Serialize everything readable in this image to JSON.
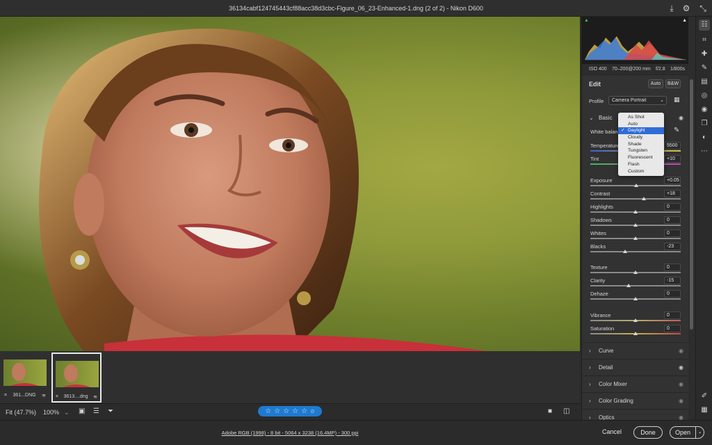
{
  "window": {
    "title": "36134cabf124745443cf88acc38d3cbc-Figure_06_23-Enhanced-1.dng (2 of 2)  -  Nikon D600"
  },
  "filmstrip": {
    "items": [
      {
        "label": "361...DNG"
      },
      {
        "label": "3613....dng"
      }
    ]
  },
  "viewbar": {
    "fit_label": "Fit (47.7%)",
    "zoom_label": "100%"
  },
  "rating": {
    "stars": [
      "☆",
      "☆",
      "☆",
      "☆",
      "☆"
    ]
  },
  "footer": {
    "info": "Adobe RGB (1998) - 8 bit - 5064 x 3238 (16.4MP) - 300 ppi",
    "cancel": "Cancel",
    "done": "Done",
    "open": "Open"
  },
  "exif": {
    "iso": "ISO 400",
    "lens": "70–200@200 mm",
    "aperture": "f/2.8",
    "shutter": "1/800s"
  },
  "edit": {
    "title": "Edit",
    "auto": "Auto",
    "bw": "B&W",
    "profile_label": "Profile",
    "profile_value": "Camera Portrait"
  },
  "basic": {
    "title": "Basic",
    "white_balance_label": "White balance",
    "temperature": {
      "label": "Temperature",
      "value": "5500"
    },
    "tint": {
      "label": "Tint",
      "value": "+10"
    },
    "sliders": [
      {
        "label": "Exposure",
        "value": "+0.05",
        "pos": 0.505
      },
      {
        "label": "Contrast",
        "value": "+18",
        "pos": 0.59
      },
      {
        "label": "Highlights",
        "value": "0",
        "pos": 0.5
      },
      {
        "label": "Shadows",
        "value": "0",
        "pos": 0.5
      },
      {
        "label": "Whites",
        "value": "0",
        "pos": 0.5
      },
      {
        "label": "Blacks",
        "value": "-23",
        "pos": 0.385
      }
    ],
    "presence": [
      {
        "label": "Texture",
        "value": "0",
        "pos": 0.5
      },
      {
        "label": "Clarity",
        "value": "-15",
        "pos": 0.425
      },
      {
        "label": "Dehaze",
        "value": "0",
        "pos": 0.5
      }
    ],
    "color": [
      {
        "label": "Vibrance",
        "value": "0",
        "pos": 0.5
      },
      {
        "label": "Saturation",
        "value": "0",
        "pos": 0.5
      }
    ]
  },
  "wb_menu": {
    "options": [
      "As Shot",
      "Auto",
      "Daylight",
      "Cloudy",
      "Shade",
      "Tungsten",
      "Fluorescent",
      "Flash",
      "Custom"
    ],
    "selected": "Daylight"
  },
  "sections": [
    {
      "label": "Curve"
    },
    {
      "label": "Detail"
    },
    {
      "label": "Color Mixer"
    },
    {
      "label": "Color Grading"
    },
    {
      "label": "Optics"
    }
  ],
  "colors": {
    "accent": "#1f7ad1",
    "menu_selected": "#2f6dd6"
  }
}
